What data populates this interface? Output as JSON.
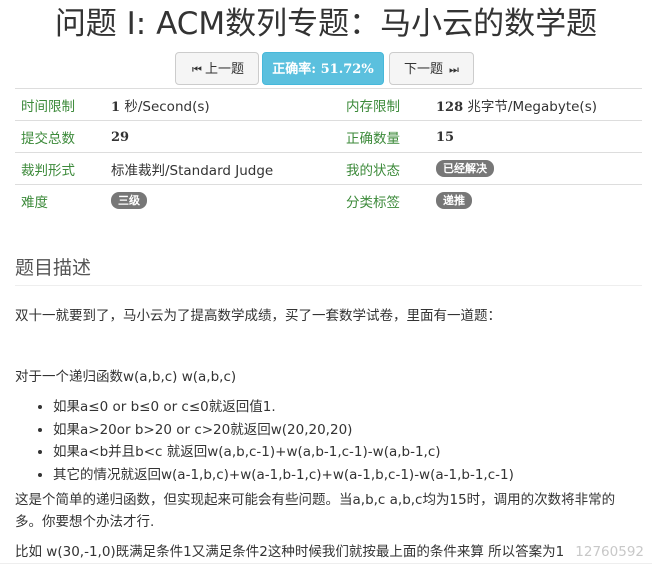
{
  "page": {
    "title": "问题 I: ACM数列专题：马小云的数学题"
  },
  "nav": {
    "prev_glyph": "⏮",
    "prev_label": "上一题",
    "rate_label": "正确率: 51.72%",
    "next_label": "下一题",
    "next_glyph": "⏭"
  },
  "info": {
    "time_limit_label": "时间限制",
    "time_limit_num": "1",
    "time_limit_unit": " 秒/Second(s)",
    "memory_limit_label": "内存限制",
    "memory_limit_num": "128",
    "memory_limit_unit": " 兆字节/Megabyte(s)",
    "submit_total_label": "提交总数",
    "submit_total_value": "29",
    "correct_count_label": "正确数量",
    "correct_count_value": "15",
    "judge_type_label": "裁判形式",
    "judge_type_value": "标准裁判/Standard Judge",
    "my_status_label": "我的状态",
    "my_status_value": "已经解决",
    "difficulty_label": "难度",
    "difficulty_value": "三级",
    "category_label": "分类标签",
    "category_value": "递推"
  },
  "description": {
    "heading": "题目描述",
    "intro": "双十一就要到了，马小云为了提高数学成绩，买了一套数学试卷，里面有一道题：",
    "function_line": "对于一个递归函数w(a,b,c) w(a,b,c)",
    "rules": [
      "如果a≤0 or b≤0 or c≤0就返回值1.",
      "如果a>20or b>20 or c>20就返回w(20,20,20)",
      "如果a<b并且b<c 就返回w(a,b,c-1)+w(a,b-1,c-1)-w(a,b-1,c)",
      "其它的情况就返回w(a-1,b,c)+w(a-1,b-1,c)+w(a-1,b,c-1)-w(a-1,b-1,c-1)"
    ],
    "note": "这是个简单的递归函数，但实现起来可能会有些问题。当a,b,c a,b,c均为15时，调用的次数将非常的多。你要想个办法才行.",
    "example": "比如 w(30,-1,0)既满足条件1又满足条件2这种时候我们就按最上面的条件来算 所以答案为1",
    "watermark": "12760592"
  }
}
